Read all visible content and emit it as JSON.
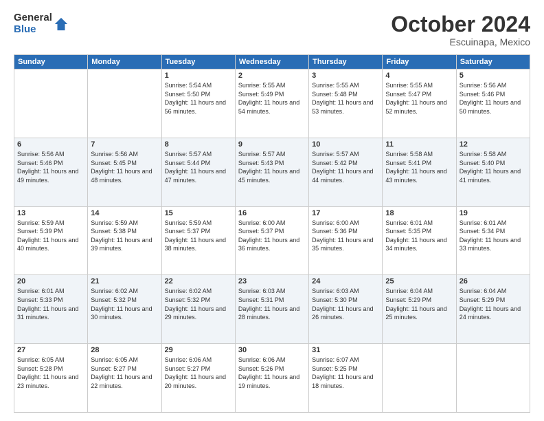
{
  "logo": {
    "general": "General",
    "blue": "Blue"
  },
  "header": {
    "month": "October 2024",
    "location": "Escuinapa, Mexico"
  },
  "weekdays": [
    "Sunday",
    "Monday",
    "Tuesday",
    "Wednesday",
    "Thursday",
    "Friday",
    "Saturday"
  ],
  "weeks": [
    [
      {
        "day": "",
        "info": ""
      },
      {
        "day": "",
        "info": ""
      },
      {
        "day": "1",
        "info": "Sunrise: 5:54 AM\nSunset: 5:50 PM\nDaylight: 11 hours and 56 minutes."
      },
      {
        "day": "2",
        "info": "Sunrise: 5:55 AM\nSunset: 5:49 PM\nDaylight: 11 hours and 54 minutes."
      },
      {
        "day": "3",
        "info": "Sunrise: 5:55 AM\nSunset: 5:48 PM\nDaylight: 11 hours and 53 minutes."
      },
      {
        "day": "4",
        "info": "Sunrise: 5:55 AM\nSunset: 5:47 PM\nDaylight: 11 hours and 52 minutes."
      },
      {
        "day": "5",
        "info": "Sunrise: 5:56 AM\nSunset: 5:46 PM\nDaylight: 11 hours and 50 minutes."
      }
    ],
    [
      {
        "day": "6",
        "info": "Sunrise: 5:56 AM\nSunset: 5:46 PM\nDaylight: 11 hours and 49 minutes."
      },
      {
        "day": "7",
        "info": "Sunrise: 5:56 AM\nSunset: 5:45 PM\nDaylight: 11 hours and 48 minutes."
      },
      {
        "day": "8",
        "info": "Sunrise: 5:57 AM\nSunset: 5:44 PM\nDaylight: 11 hours and 47 minutes."
      },
      {
        "day": "9",
        "info": "Sunrise: 5:57 AM\nSunset: 5:43 PM\nDaylight: 11 hours and 45 minutes."
      },
      {
        "day": "10",
        "info": "Sunrise: 5:57 AM\nSunset: 5:42 PM\nDaylight: 11 hours and 44 minutes."
      },
      {
        "day": "11",
        "info": "Sunrise: 5:58 AM\nSunset: 5:41 PM\nDaylight: 11 hours and 43 minutes."
      },
      {
        "day": "12",
        "info": "Sunrise: 5:58 AM\nSunset: 5:40 PM\nDaylight: 11 hours and 41 minutes."
      }
    ],
    [
      {
        "day": "13",
        "info": "Sunrise: 5:59 AM\nSunset: 5:39 PM\nDaylight: 11 hours and 40 minutes."
      },
      {
        "day": "14",
        "info": "Sunrise: 5:59 AM\nSunset: 5:38 PM\nDaylight: 11 hours and 39 minutes."
      },
      {
        "day": "15",
        "info": "Sunrise: 5:59 AM\nSunset: 5:37 PM\nDaylight: 11 hours and 38 minutes."
      },
      {
        "day": "16",
        "info": "Sunrise: 6:00 AM\nSunset: 5:37 PM\nDaylight: 11 hours and 36 minutes."
      },
      {
        "day": "17",
        "info": "Sunrise: 6:00 AM\nSunset: 5:36 PM\nDaylight: 11 hours and 35 minutes."
      },
      {
        "day": "18",
        "info": "Sunrise: 6:01 AM\nSunset: 5:35 PM\nDaylight: 11 hours and 34 minutes."
      },
      {
        "day": "19",
        "info": "Sunrise: 6:01 AM\nSunset: 5:34 PM\nDaylight: 11 hours and 33 minutes."
      }
    ],
    [
      {
        "day": "20",
        "info": "Sunrise: 6:01 AM\nSunset: 5:33 PM\nDaylight: 11 hours and 31 minutes."
      },
      {
        "day": "21",
        "info": "Sunrise: 6:02 AM\nSunset: 5:32 PM\nDaylight: 11 hours and 30 minutes."
      },
      {
        "day": "22",
        "info": "Sunrise: 6:02 AM\nSunset: 5:32 PM\nDaylight: 11 hours and 29 minutes."
      },
      {
        "day": "23",
        "info": "Sunrise: 6:03 AM\nSunset: 5:31 PM\nDaylight: 11 hours and 28 minutes."
      },
      {
        "day": "24",
        "info": "Sunrise: 6:03 AM\nSunset: 5:30 PM\nDaylight: 11 hours and 26 minutes."
      },
      {
        "day": "25",
        "info": "Sunrise: 6:04 AM\nSunset: 5:29 PM\nDaylight: 11 hours and 25 minutes."
      },
      {
        "day": "26",
        "info": "Sunrise: 6:04 AM\nSunset: 5:29 PM\nDaylight: 11 hours and 24 minutes."
      }
    ],
    [
      {
        "day": "27",
        "info": "Sunrise: 6:05 AM\nSunset: 5:28 PM\nDaylight: 11 hours and 23 minutes."
      },
      {
        "day": "28",
        "info": "Sunrise: 6:05 AM\nSunset: 5:27 PM\nDaylight: 11 hours and 22 minutes."
      },
      {
        "day": "29",
        "info": "Sunrise: 6:06 AM\nSunset: 5:27 PM\nDaylight: 11 hours and 20 minutes."
      },
      {
        "day": "30",
        "info": "Sunrise: 6:06 AM\nSunset: 5:26 PM\nDaylight: 11 hours and 19 minutes."
      },
      {
        "day": "31",
        "info": "Sunrise: 6:07 AM\nSunset: 5:25 PM\nDaylight: 11 hours and 18 minutes."
      },
      {
        "day": "",
        "info": ""
      },
      {
        "day": "",
        "info": ""
      }
    ]
  ]
}
